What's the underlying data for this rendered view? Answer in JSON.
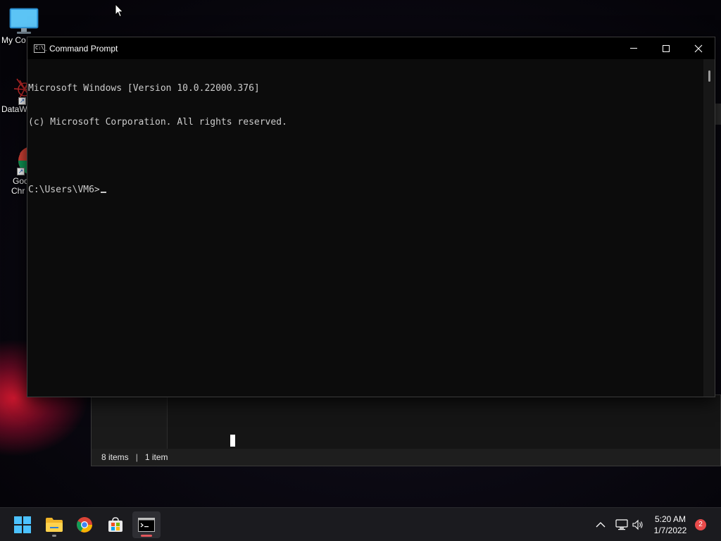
{
  "desktop": {
    "icons": [
      {
        "label": "My Co"
      },
      {
        "label": "DataW"
      },
      {
        "label_line1": "Goo",
        "label_line2": "Chr"
      }
    ]
  },
  "explorer": {
    "status_items": "8 items",
    "status_selected": "1 item"
  },
  "cmd": {
    "title": "Command Prompt",
    "lines": {
      "line1": "Microsoft Windows [Version 10.0.22000.376]",
      "line2": "(c) Microsoft Corporation. All rights reserved.",
      "prompt": "C:\\Users\\VM6>"
    }
  },
  "taskbar": {
    "clock_time": "5:20 AM",
    "clock_date": "1/7/2022",
    "notification_count": "2"
  },
  "colors": {
    "terminal_bg": "#0c0c0c",
    "terminal_text": "#cccccc",
    "taskbar_bg": "#1b1b1f",
    "active_indicator": "#e2575c",
    "badge": "#e84a4a"
  }
}
